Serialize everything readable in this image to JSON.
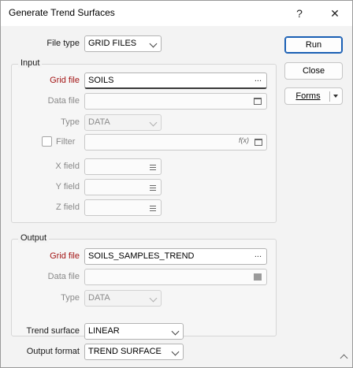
{
  "window": {
    "title": "Generate Trend Surfaces",
    "help_label": "?",
    "close_label": "✕"
  },
  "file_type": {
    "label": "File type",
    "value": "GRID FILES"
  },
  "input": {
    "group_label": "Input",
    "grid_file_label": "Grid file",
    "grid_file_value": "SOILS",
    "grid_file_button": "...",
    "data_file_label": "Data file",
    "data_file_value": "",
    "type_label": "Type",
    "type_value": "DATA",
    "filter_label": "Filter",
    "filter_value": "",
    "filter_fx": "f(x)",
    "x_field_label": "X field",
    "y_field_label": "Y field",
    "z_field_label": "Z field"
  },
  "output": {
    "group_label": "Output",
    "grid_file_label": "Grid file",
    "grid_file_value": "SOILS_SAMPLES_TREND",
    "grid_file_button": "...",
    "data_file_label": "Data file",
    "data_file_value": "",
    "type_label": "Type",
    "type_value": "DATA"
  },
  "trend_surface": {
    "label": "Trend surface",
    "value": "LINEAR"
  },
  "output_format": {
    "label": "Output format",
    "value": "TREND SURFACE"
  },
  "buttons": {
    "run": "Run",
    "close": "Close",
    "forms": "Forms"
  },
  "colors": {
    "required_label": "#a31515",
    "primary_border": "#1a5fb4"
  }
}
